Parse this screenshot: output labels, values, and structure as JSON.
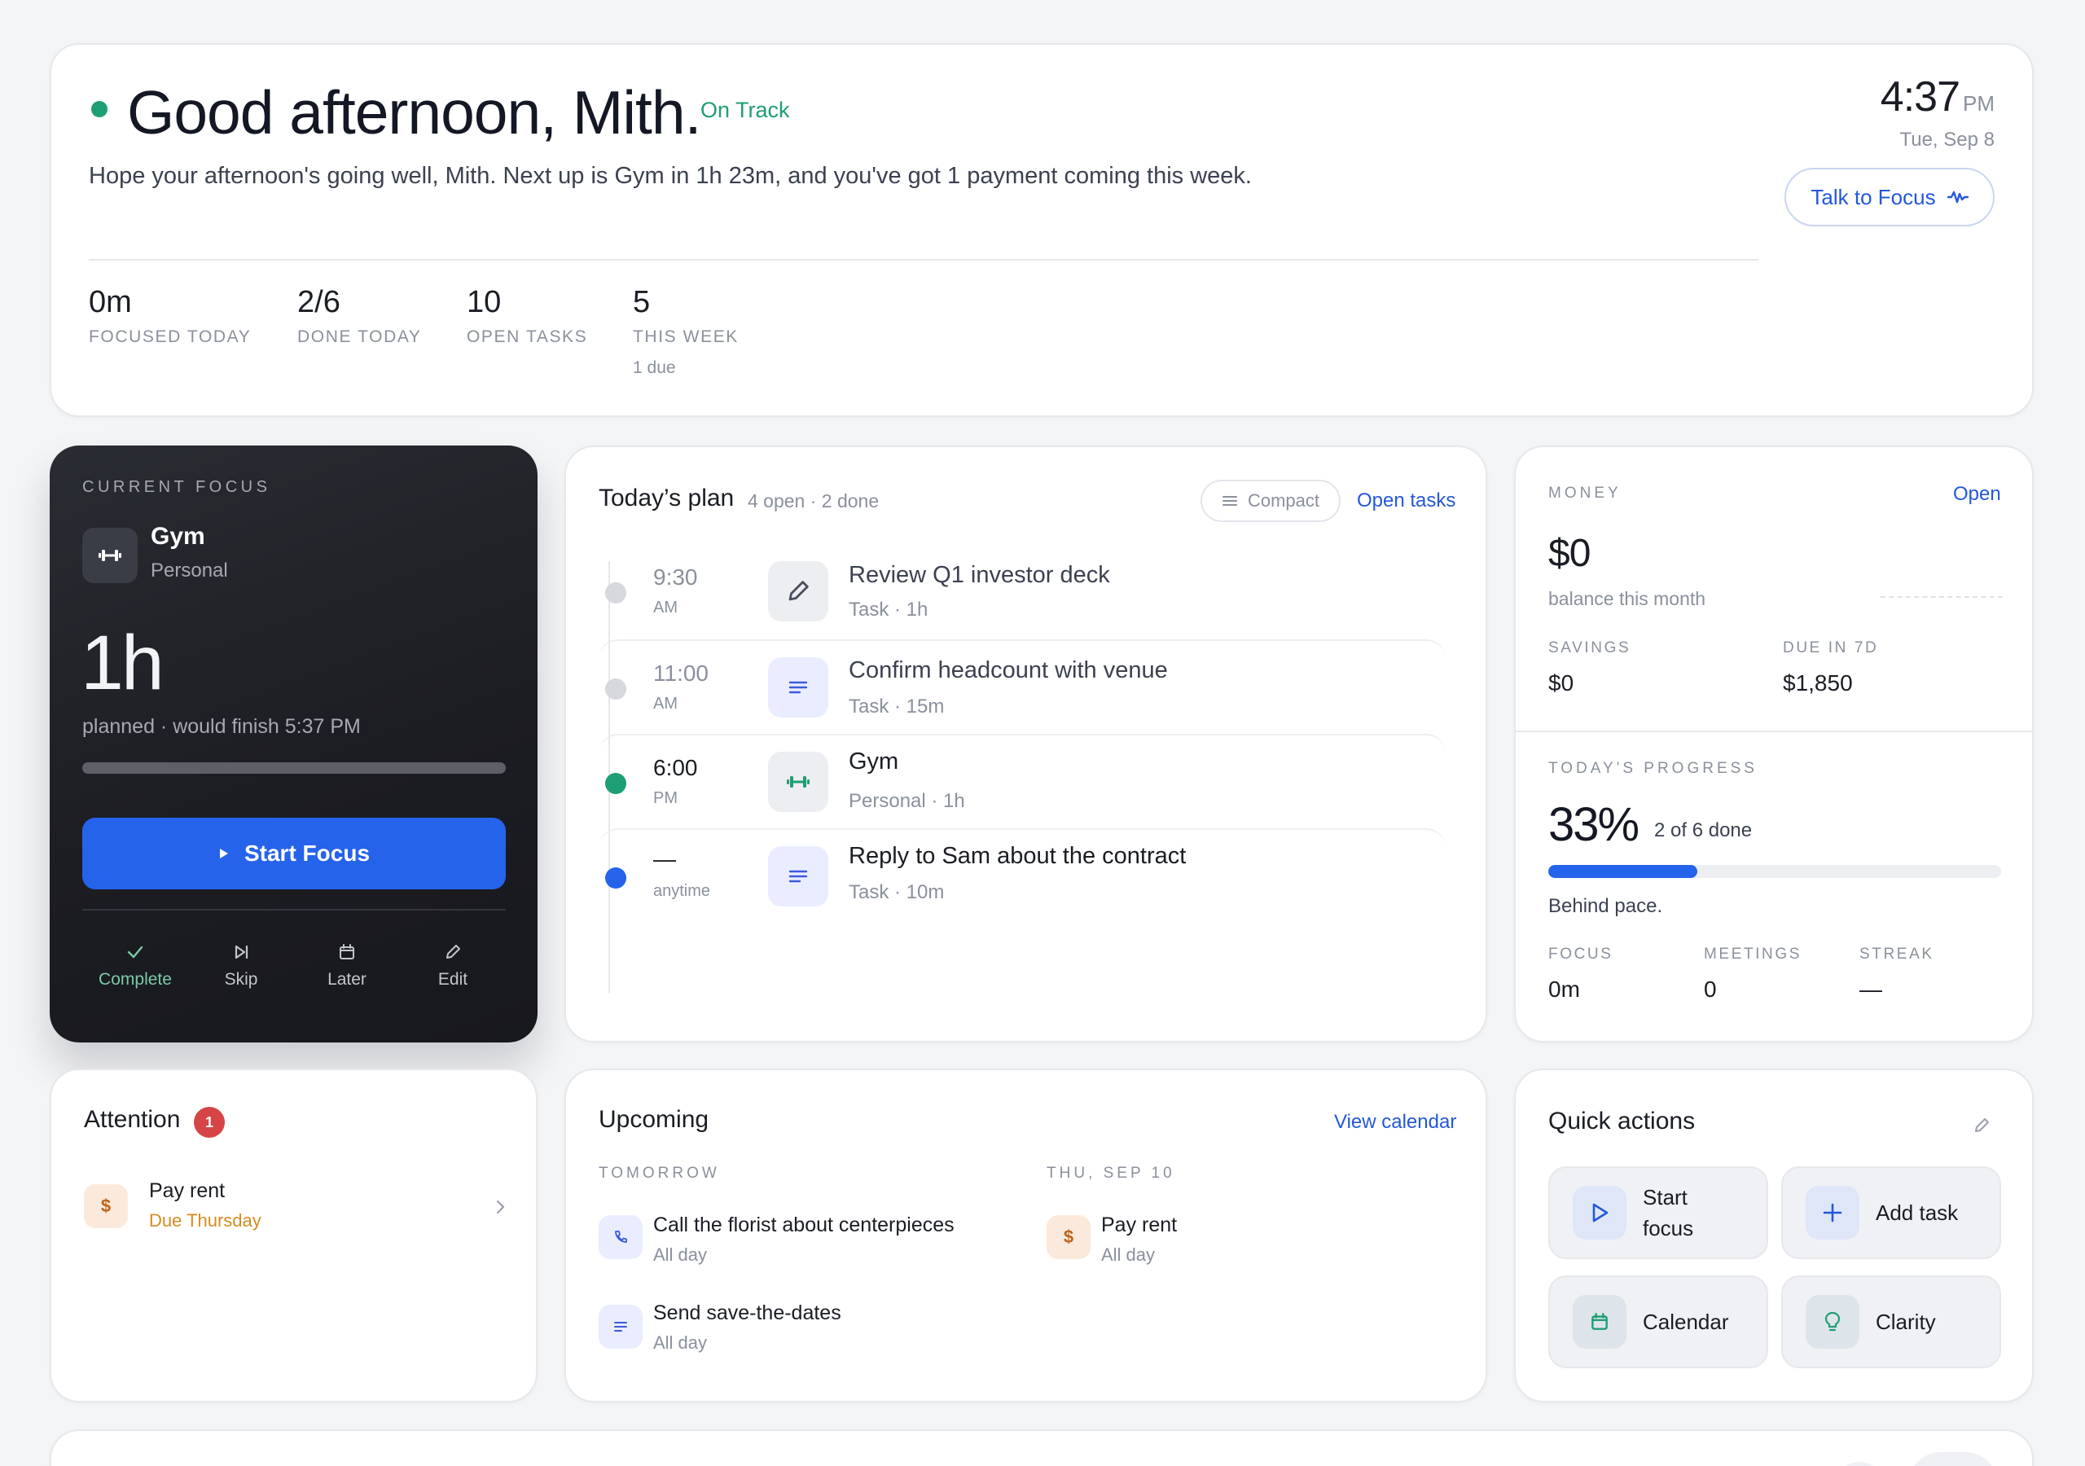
{
  "hero": {
    "greeting": "Good afternoon, Mith.",
    "status": "On Track",
    "summary": "Hope your afternoon's going well, Mith. Next up is Gym in 1h 23m, and you've got 1 payment coming this week.",
    "time": "4:37",
    "ampm": "PM",
    "date": "Tue, Sep 8",
    "talk_button": "Talk to Focus",
    "stats": [
      {
        "value": "0m",
        "label": "FOCUSED TODAY"
      },
      {
        "value": "2/6",
        "label": "DONE TODAY"
      },
      {
        "value": "10",
        "label": "OPEN TASKS"
      },
      {
        "value": "5",
        "label": "THIS WEEK",
        "extra": "1 due"
      }
    ]
  },
  "focus": {
    "eyebrow": "CURRENT FOCUS",
    "name": "Gym",
    "category": "Personal",
    "duration": "1h",
    "note": "planned · would finish 5:37 PM",
    "start_label": "Start Focus",
    "actions": [
      "Complete",
      "Skip",
      "Later",
      "Edit"
    ]
  },
  "plan": {
    "title": "Today’s plan",
    "meta": "4 open · 2 done",
    "compact_label": "Compact",
    "open_tasks_label": "Open tasks",
    "items": [
      {
        "time": "9:30",
        "ampm": "AM",
        "name": "Review Q1 investor deck",
        "sub": "Task · 1h",
        "icon": "pencil-icon"
      },
      {
        "time": "11:00",
        "ampm": "AM",
        "name": "Confirm headcount with venue",
        "sub": "Task · 15m",
        "icon": "lines-icon"
      },
      {
        "time": "6:00",
        "ampm": "PM",
        "name": "Gym",
        "sub": "Personal · 1h",
        "icon": "dumbbell-icon"
      },
      {
        "time": "—",
        "ampm": "anytime",
        "name": "Reply to Sam about the contract",
        "sub": "Task · 10m",
        "icon": "lines-icon"
      }
    ]
  },
  "money": {
    "eyebrow": "MONEY",
    "open_label": "Open",
    "balance": "$0",
    "balance_label": "balance this month",
    "savings_label": "SAVINGS",
    "savings": "$0",
    "due_label": "DUE IN 7D",
    "due": "$1,850"
  },
  "progress": {
    "eyebrow": "TODAY'S PROGRESS",
    "percent_text": "33%",
    "percent": 33,
    "summary": "2 of 6 done",
    "note": "Behind pace.",
    "metrics": [
      {
        "label": "FOCUS",
        "value": "0m"
      },
      {
        "label": "MEETINGS",
        "value": "0"
      },
      {
        "label": "STREAK",
        "value": "—"
      }
    ]
  },
  "attention": {
    "title": "Attention",
    "count": "1",
    "items": [
      {
        "name": "Pay rent",
        "sub": "Due Thursday",
        "icon": "dollar-icon"
      }
    ]
  },
  "upcoming": {
    "title": "Upcoming",
    "link": "View calendar",
    "tomorrow_label": "TOMORROW",
    "thu_label": "THU, SEP 10",
    "tomorrow": [
      {
        "name": "Call the florist about centerpieces",
        "sub": "All day",
        "icon": "phone-icon"
      },
      {
        "name": "Send save-the-dates",
        "sub": "All day",
        "icon": "lines-icon"
      }
    ],
    "thu": [
      {
        "name": "Pay rent",
        "sub": "All day",
        "icon": "dollar-icon"
      }
    ]
  },
  "quick": {
    "title": "Quick actions",
    "actions": [
      {
        "label": "Start focus",
        "icon": "play-icon"
      },
      {
        "label": "Add task",
        "icon": "plus-icon"
      },
      {
        "label": "Calendar",
        "icon": "calendar-icon"
      },
      {
        "label": "Clarity",
        "icon": "bulb-icon"
      }
    ]
  },
  "colors": {
    "accent": "#2563eb",
    "success": "#1e9e74",
    "warning": "#d98a1f",
    "danger": "#d64545"
  }
}
